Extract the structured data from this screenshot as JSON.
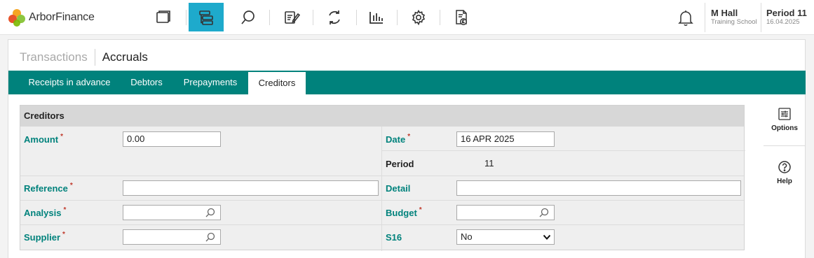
{
  "app": {
    "brand": "ArborFinance",
    "nav_icons": [
      "folder-icon",
      "hierarchy-icon",
      "search-icon",
      "notes-edit-icon",
      "refresh-cycle-icon",
      "bar-chart-icon",
      "gear-icon",
      "report-document-icon"
    ],
    "active_nav": "hierarchy-icon",
    "accent_color": "#1eaacc"
  },
  "user": {
    "name": "M Hall",
    "school": "Training School"
  },
  "period": {
    "label": "Period 11",
    "date": "16.04.2025"
  },
  "breadcrumb": {
    "parent": "Transactions",
    "current": "Accruals"
  },
  "tabs": [
    {
      "label": "Receipts in advance"
    },
    {
      "label": "Debtors"
    },
    {
      "label": "Prepayments"
    },
    {
      "label": "Creditors"
    }
  ],
  "active_tab": "Creditors",
  "theme": {
    "tab_bar_color": "#00827c",
    "label_color": "#00827c",
    "required_color": "#c0392b"
  },
  "form": {
    "title": "Creditors",
    "required_marker": "*",
    "amount": {
      "label": "Amount",
      "value": "0.00"
    },
    "date": {
      "label": "Date",
      "value": "16 APR 2025"
    },
    "period": {
      "label": "Period",
      "value": "11"
    },
    "reference": {
      "label": "Reference",
      "value": ""
    },
    "detail": {
      "label": "Detail",
      "value": ""
    },
    "analysis": {
      "label": "Analysis",
      "value": ""
    },
    "budget": {
      "label": "Budget",
      "value": ""
    },
    "supplier": {
      "label": "Supplier",
      "value": ""
    },
    "s16": {
      "label": "S16",
      "value": "No"
    }
  },
  "side_actions": [
    {
      "label": "Options",
      "icon": "sliders-icon"
    },
    {
      "label": "Help",
      "icon": "help-circle-icon"
    }
  ]
}
